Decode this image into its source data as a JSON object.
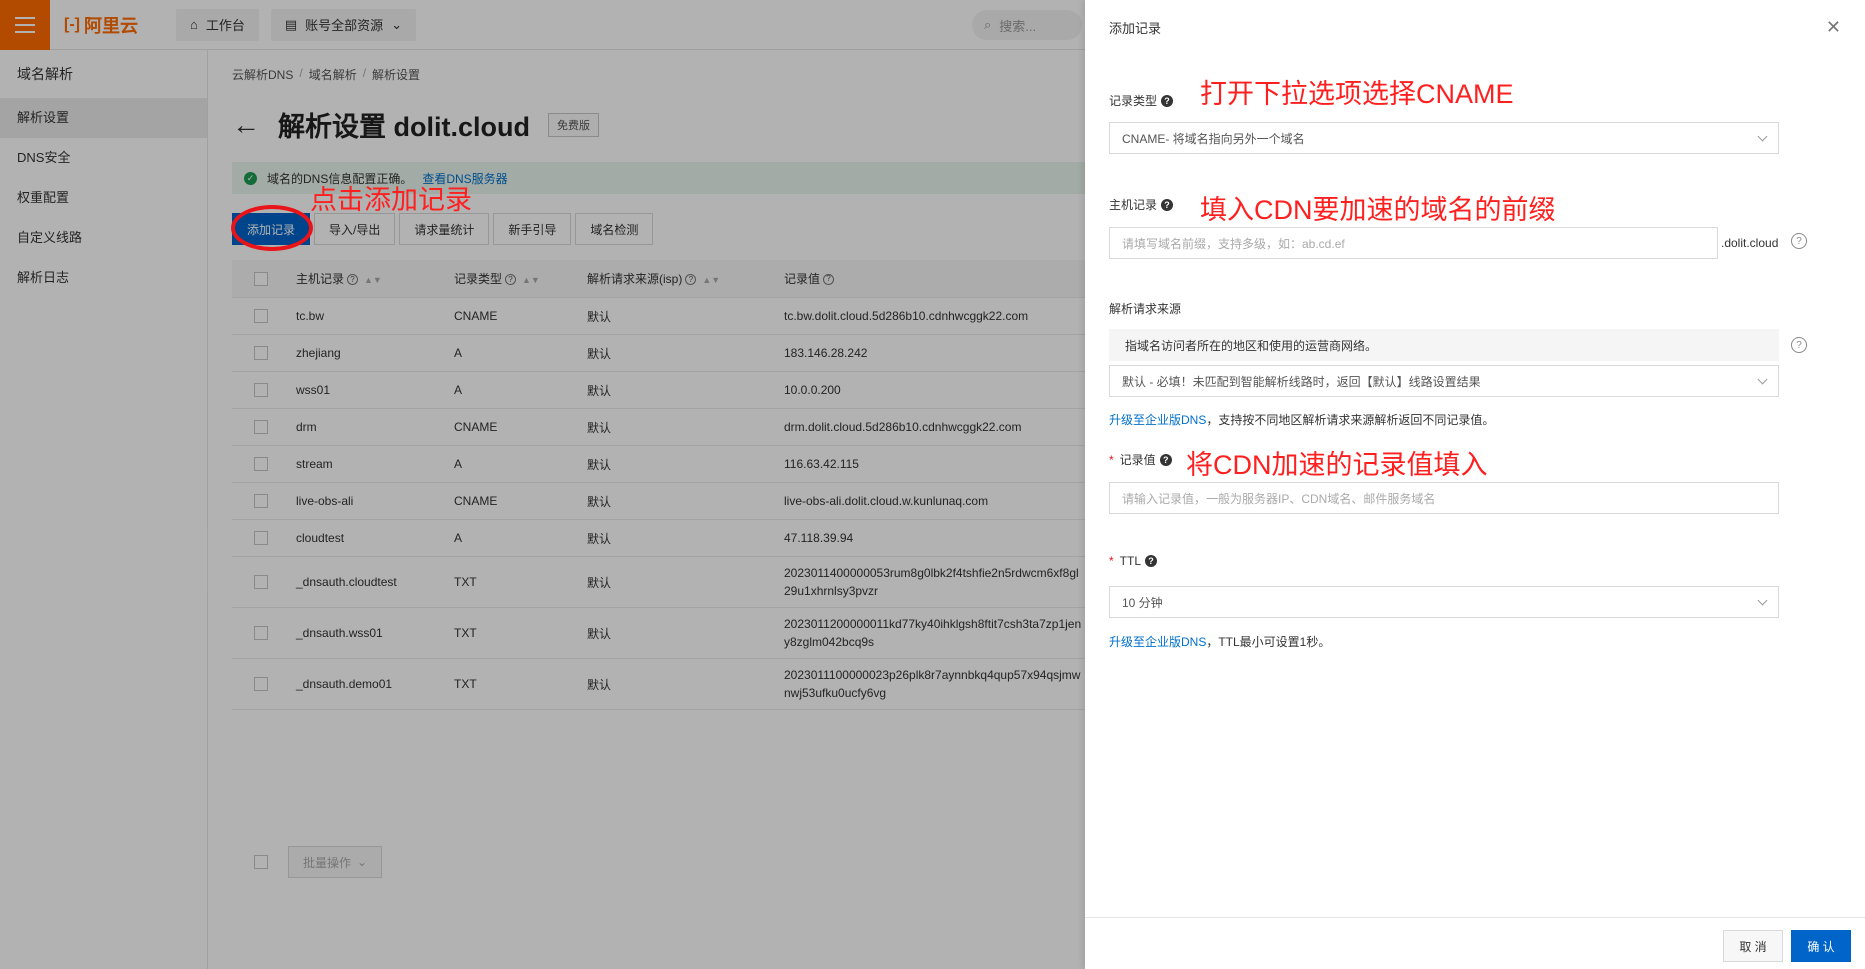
{
  "topbar": {
    "logo_text": "阿里云",
    "workbench": "工作台",
    "resources": "账号全部资源",
    "search_placeholder": "搜索..."
  },
  "sidebar": {
    "title": "域名解析",
    "items": [
      {
        "label": "解析设置",
        "active": true
      },
      {
        "label": "DNS安全"
      },
      {
        "label": "权重配置"
      },
      {
        "label": "自定义线路"
      },
      {
        "label": "解析日志"
      }
    ]
  },
  "breadcrumb": [
    "云解析DNS",
    "域名解析",
    "解析设置"
  ],
  "page": {
    "title": "解析设置 dolit.cloud",
    "badge": "免费版"
  },
  "notice": {
    "text": "域名的DNS信息配置正确。",
    "link": "查看DNS服务器"
  },
  "toolbar": {
    "add": "添加记录",
    "import_export": "导入/导出",
    "stats": "请求量统计",
    "guide": "新手引导",
    "check": "域名检测"
  },
  "table": {
    "headers": {
      "host": "主机记录",
      "type": "记录类型",
      "line": "解析请求来源(isp)",
      "value": "记录值"
    },
    "rows": [
      {
        "host": "tc.bw",
        "type": "CNAME",
        "line": "默认",
        "value": "tc.bw.dolit.cloud.5d286b10.cdnhwcggk22.com"
      },
      {
        "host": "zhejiang",
        "type": "A",
        "line": "默认",
        "value": "183.146.28.242"
      },
      {
        "host": "wss01",
        "type": "A",
        "line": "默认",
        "value": "10.0.0.200"
      },
      {
        "host": "drm",
        "type": "CNAME",
        "line": "默认",
        "value": "drm.dolit.cloud.5d286b10.cdnhwcggk22.com"
      },
      {
        "host": "stream",
        "type": "A",
        "line": "默认",
        "value": "116.63.42.115"
      },
      {
        "host": "live-obs-ali",
        "type": "CNAME",
        "line": "默认",
        "value": "live-obs-ali.dolit.cloud.w.kunlunaq.com"
      },
      {
        "host": "cloudtest",
        "type": "A",
        "line": "默认",
        "value": "47.118.39.94"
      },
      {
        "host": "_dnsauth.cloudtest",
        "type": "TXT",
        "line": "默认",
        "value": "2023011400000053rum8g0lbk2f4tshfie2n5rdwcm6xf8gl",
        "value2": "29u1xhrnlsy3pvzr"
      },
      {
        "host": "_dnsauth.wss01",
        "type": "TXT",
        "line": "默认",
        "value": "2023011200000011kd77ky40ihklgsh8ftit7csh3ta7zp1jen",
        "value2": "y8zglm042bcq9s"
      },
      {
        "host": "_dnsauth.demo01",
        "type": "TXT",
        "line": "默认",
        "value": "2023011100000023p26plk8r7aynnbkq4qup57x94qsjmw",
        "value2": "nwj53ufku0ucfy6vg"
      }
    ],
    "batch": "批量操作"
  },
  "annotations": {
    "click_add": "点击添加记录",
    "choose_cname": "打开下拉选项选择CNAME",
    "fill_prefix": "填入CDN要加速的域名的前缀",
    "fill_value": "将CDN加速的记录值填入"
  },
  "drawer": {
    "title": "添加记录",
    "record_type": {
      "label": "记录类型",
      "value": "CNAME- 将域名指向另外一个域名"
    },
    "host": {
      "label": "主机记录",
      "placeholder": "请填写域名前缀，支持多级，如：ab.cd.ef",
      "suffix": ".dolit.cloud"
    },
    "source": {
      "label": "解析请求来源",
      "info": "指域名访问者所在的地区和使用的运营商网络。",
      "value": "默认 - 必填！未匹配到智能解析线路时，返回【默认】线路设置结果",
      "hint_link": "升级至企业版DNS",
      "hint_text": "，支持按不同地区解析请求来源解析返回不同记录值。"
    },
    "value": {
      "label": "记录值",
      "placeholder": "请输入记录值，一般为服务器IP、CDN域名、邮件服务域名"
    },
    "ttl": {
      "label": "TTL",
      "value": "10 分钟",
      "hint_link": "升级至企业版DNS",
      "hint_text": "，TTL最小可设置1秒。"
    },
    "cancel": "取 消",
    "confirm": "确 认"
  },
  "colors": {
    "brand": "#ff6a00",
    "primary": "#0064c8",
    "annotation": "#ff1f1f"
  }
}
